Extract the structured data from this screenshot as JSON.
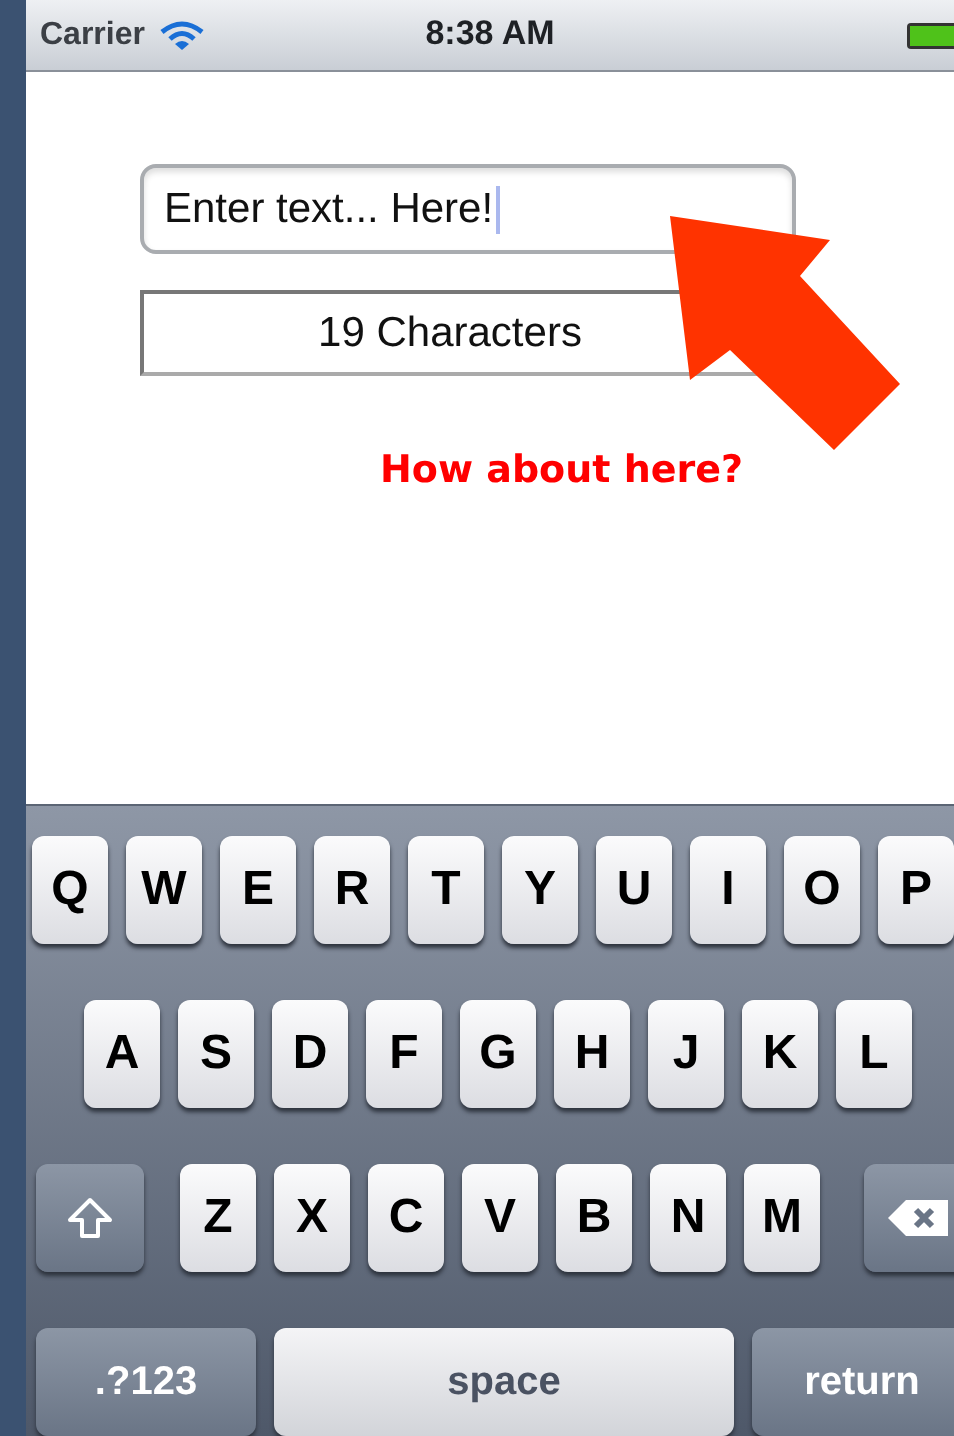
{
  "status_bar": {
    "carrier": "Carrier",
    "time": "8:38 AM"
  },
  "text_field": {
    "value": "Enter text... Here!"
  },
  "character_count": "19 Characters",
  "hint": "How about here?",
  "keyboard": {
    "top_letters": [
      "Q",
      "W",
      "E",
      "R",
      "T",
      "Y",
      "U",
      "I",
      "O",
      "P"
    ],
    "middle_letters": [
      "A",
      "S",
      "D",
      "F",
      "G",
      "H",
      "J",
      "K",
      "L"
    ],
    "bottom_letters": [
      "Z",
      "X",
      "C",
      "V",
      "B",
      "N",
      "M"
    ],
    "numbers_key": ".?123",
    "space_key": "space",
    "return_key": "return"
  }
}
